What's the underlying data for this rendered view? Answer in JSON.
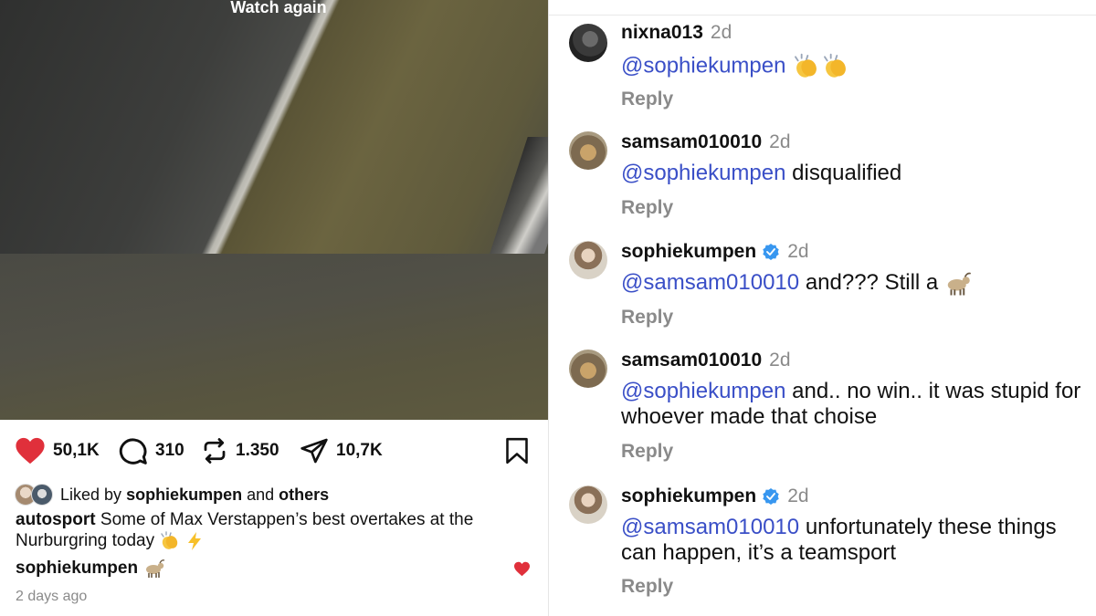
{
  "video": {
    "overlay_label": "Watch again"
  },
  "post_actions": {
    "like_count": "50,1K",
    "comment_count": "310",
    "repost_count": "1.350",
    "share_count": "10,7K",
    "icons": [
      "heart-icon",
      "comment-icon",
      "repost-icon",
      "share-icon",
      "bookmark-icon"
    ],
    "like_color": "#e0303b"
  },
  "liked_by": {
    "prefix": "Liked by",
    "user": "sophiekumpen",
    "conjunction": "and",
    "others": "others"
  },
  "caption": {
    "author": "autosport",
    "text": "Some of Max Verstappen’s best overtakes at the Nurburgring today",
    "emoji": [
      "clapping-hands",
      "high-voltage"
    ]
  },
  "owner_comment": {
    "user": "sophiekumpen",
    "emoji": "goat"
  },
  "timestamp": "2 days ago",
  "comments": [
    {
      "user": "nixna013",
      "time": "2d",
      "verified": false,
      "mention": "@sophiekumpen",
      "text": "",
      "emoji": "clapping-hands x2",
      "reply_label": "Reply"
    },
    {
      "user": "samsam010010",
      "time": "2d",
      "verified": false,
      "mention": "@sophiekumpen",
      "text": "disqualified",
      "reply_label": "Reply"
    },
    {
      "user": "sophiekumpen",
      "time": "2d",
      "verified": true,
      "mention": "@samsam010010",
      "text": "and??? Still a",
      "emoji": "goat",
      "reply_label": "Reply"
    },
    {
      "user": "samsam010010",
      "time": "2d",
      "verified": false,
      "mention": "@sophiekumpen",
      "text": "and.. no win.. it was stupid for whoever made that choise",
      "reply_label": "Reply"
    },
    {
      "user": "sophiekumpen",
      "time": "2d",
      "verified": true,
      "mention": "@samsam010010",
      "text": "unfortunately these things can happen, it’s a teamsport",
      "reply_label": "Reply"
    }
  ],
  "colors": {
    "mention": "#3a4fc7",
    "verified_badge": "#3897f0",
    "secondary_text": "#8a8a8a"
  }
}
